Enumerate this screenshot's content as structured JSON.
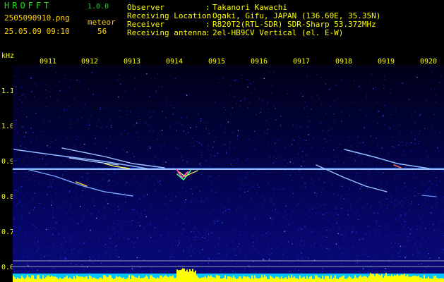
{
  "header": {
    "app_title": "HROFFT",
    "version": "1.0.0",
    "filename": "2505090910.png",
    "meteor_label": "meteor",
    "datetime": "25.05.09 09:10",
    "meteor_count": "56"
  },
  "station_info": [
    {
      "key": "Observer",
      "value": "Takanori Kawachi"
    },
    {
      "key": "Receiving Location",
      "value": "Ogaki, Gifu, JAPAN (136.60E, 35.35N)"
    },
    {
      "key": "Receiver",
      "value": "R820T2(RTL-SDR) SDR-Sharp 53.372MHz"
    },
    {
      "key": "Receiving antenna",
      "value": "2el-HB9CV Vertical (el. E-W)"
    }
  ],
  "axis": {
    "y_unit": "kHz",
    "y_ticks": [
      "1.1",
      "1.0",
      "0.9",
      "0.8",
      "0.7",
      "0.6"
    ],
    "x_ticks": [
      "0911",
      "0912",
      "0913",
      "0914",
      "0915",
      "0916",
      "0917",
      "0918",
      "0919",
      "0920"
    ]
  },
  "colors": {
    "header_green": "#18e018",
    "label_yellow": "#ffff00",
    "background_noise": "#0a0a7a",
    "carrier": "#9fd0ff",
    "baseline_bars": "#ffff00",
    "baseline_fill": "#00c8ff"
  }
}
